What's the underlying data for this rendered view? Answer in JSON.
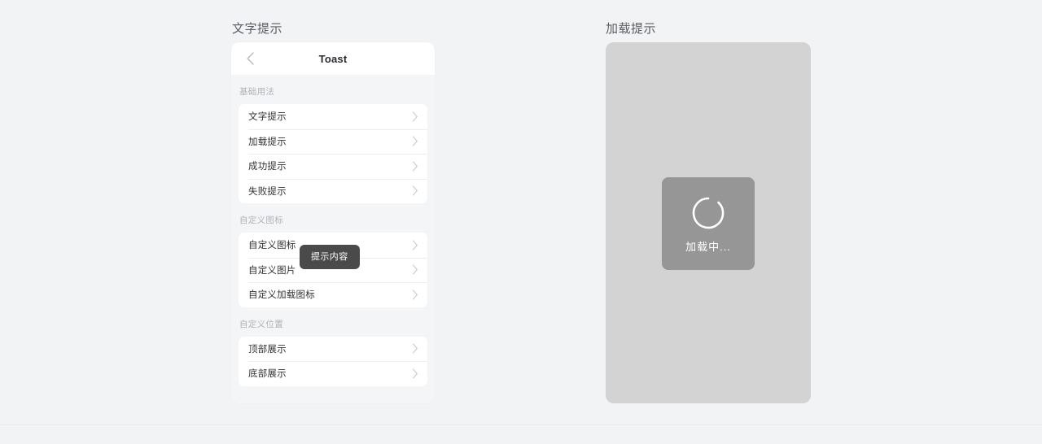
{
  "page": {
    "background_color": "#f2f3f5"
  },
  "sections": {
    "left_title": "文字提示",
    "right_title": "加载提示"
  },
  "phone": {
    "nav": {
      "back_icon": "chevron-left-icon",
      "title": "Toast"
    },
    "groups": [
      {
        "title": "基础用法",
        "items": [
          {
            "label": "文字提示",
            "arrow_icon": "chevron-right-icon"
          },
          {
            "label": "加载提示",
            "arrow_icon": "chevron-right-icon"
          },
          {
            "label": "成功提示",
            "arrow_icon": "chevron-right-icon"
          },
          {
            "label": "失败提示",
            "arrow_icon": "chevron-right-icon"
          }
        ]
      },
      {
        "title": "自定义图标",
        "items": [
          {
            "label": "自定义图标",
            "arrow_icon": "chevron-right-icon"
          },
          {
            "label": "自定义图片",
            "arrow_icon": "chevron-right-icon"
          },
          {
            "label": "自定义加载图标",
            "arrow_icon": "chevron-right-icon"
          }
        ]
      },
      {
        "title": "自定义位置",
        "items": [
          {
            "label": "顶部展示",
            "arrow_icon": "chevron-right-icon"
          },
          {
            "label": "底部展示",
            "arrow_icon": "chevron-right-icon"
          }
        ]
      }
    ],
    "text_toast": {
      "message": "提示内容",
      "background_color": "#4a4a4a",
      "text_color": "#ffffff"
    }
  },
  "overlay": {
    "background_color": "#d3d3d3",
    "loading_toast": {
      "spinner_icon": "loading-spinner-icon",
      "message": "加载中...",
      "background_color": "#969696",
      "text_color": "#ffffff"
    }
  }
}
